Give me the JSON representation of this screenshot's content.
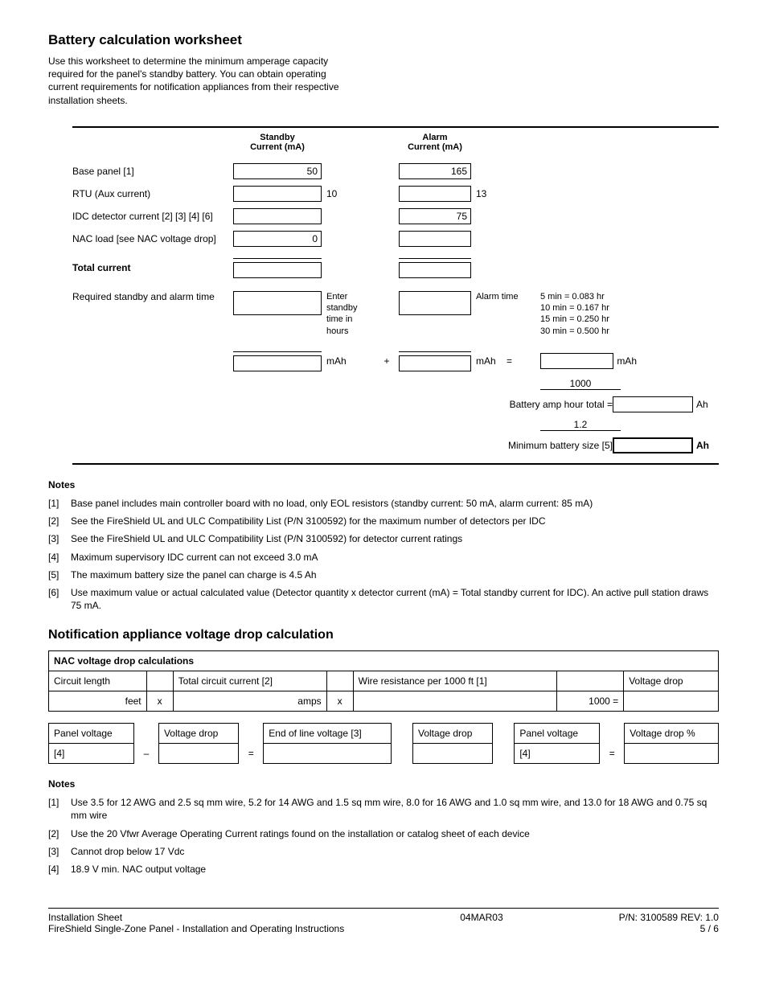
{
  "section1": {
    "title": "Battery calculation worksheet",
    "intro": "Use this worksheet to determine the minimum amperage capacity required for the panel's standby battery. You can obtain operating current requirements for notification appliances from their respective installation sheets.",
    "head_standby": "Standby\nCurrent (mA)",
    "head_alarm": "Alarm\nCurrent (mA)",
    "rows": {
      "base": {
        "label": "Base panel [1]",
        "standby": "50",
        "alarm": "165"
      },
      "rtu": {
        "label": "RTU (Aux current)",
        "standby_note": "10",
        "alarm_note": "13"
      },
      "idc": {
        "label": "IDC detector current [2] [3] [4] [6]",
        "alarm": "75"
      },
      "nac": {
        "label": "NAC load [see NAC voltage drop]",
        "standby": "0"
      },
      "total": {
        "label": "Total current"
      },
      "time": {
        "label": "Required standby and alarm time",
        "standby_note": "Enter standby time in hours",
        "alarm_note": "Alarm time",
        "conversions": "5 min = 0.083 hr\n10 min = 0.167 hr\n15 min = 0.250 hr\n30 min = 0.500 hr"
      },
      "mah": {
        "standby_unit": "mAh",
        "plus": "+",
        "alarm_unit": "mAh",
        "eq": "=",
        "total_unit": "mAh"
      },
      "divisor": "1000",
      "ah_total": {
        "label": "Battery amp hour total =",
        "unit": "Ah"
      },
      "factor": "1.2",
      "min_batt": {
        "label": "Minimum battery size [5]",
        "unit": "Ah"
      }
    }
  },
  "notes1": {
    "title": "Notes",
    "items": [
      {
        "n": "[1]",
        "t": "Base panel includes main controller board with no load, only EOL resistors (standby current: 50 mA, alarm current: 85 mA)"
      },
      {
        "n": "[2]",
        "t": "See the FireShield UL and ULC Compatibility List (P/N 3100592) for the maximum number of detectors per IDC"
      },
      {
        "n": "[3]",
        "t": "See the FireShield UL and ULC Compatibility List (P/N 3100592) for detector current ratings"
      },
      {
        "n": "[4]",
        "t": "Maximum supervisory IDC current can not exceed 3.0 mA"
      },
      {
        "n": "[5]",
        "t": "The maximum battery size the panel can charge is 4.5 Ah"
      },
      {
        "n": "[6]",
        "t": "Use maximum value or actual calculated value (Detector quantity x detector current (mA) = Total standby current for IDC). An active pull station draws 75 mA."
      }
    ]
  },
  "section2": {
    "title": "Notification appliance voltage drop calculation",
    "tableA": {
      "head": "NAC voltage drop calculations",
      "h1": "Circuit length",
      "h2": "Total circuit current [2]",
      "h3": "Wire resistance per 1000 ft [1]",
      "h4": "Voltage drop",
      "u1": "feet",
      "op1": "x",
      "u2": "amps",
      "op2": "x",
      "u3": "1000  =",
      "rowB": ""
    },
    "tableB": {
      "h1": "Panel voltage",
      "h2": "Voltage drop",
      "h3": "End of line voltage [3]",
      "h4": "Voltage drop",
      "h5": "Panel voltage",
      "h6": "Voltage drop %",
      "v1": "[4]",
      "op1": "–",
      "op2": "=",
      "v5": "[4]",
      "op3": "="
    }
  },
  "notes2": {
    "title": "Notes",
    "items": [
      {
        "n": "[1]",
        "t": "Use 3.5    for 12 AWG and 2.5 sq mm wire, 5.2    for 14 AWG and 1.5 sq mm wire, 8.0    for 16 AWG and 1.0 sq mm wire, and 13.0    for 18 AWG and 0.75 sq mm wire"
      },
      {
        "n": "[2]",
        "t": "Use the 20 Vfwr Average Operating Current ratings found on the installation or catalog sheet of each device"
      },
      {
        "n": "[3]",
        "t": "Cannot drop below 17 Vdc"
      },
      {
        "n": "[4]",
        "t": "18.9 V min. NAC output voltage"
      }
    ]
  },
  "footer": {
    "l1": "Installation Sheet",
    "l2": "FireShield Single-Zone Panel - Installation and Operating Instructions",
    "mid": "04MAR03",
    "r1": "P/N: 3100589 REV: 1.0",
    "r2": "5 / 6"
  }
}
